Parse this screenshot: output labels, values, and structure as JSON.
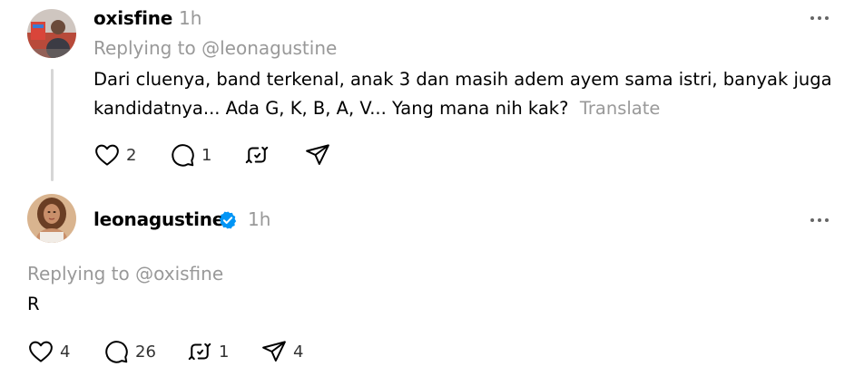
{
  "post1": {
    "username": "oxisfine",
    "time": "1h",
    "replying_to": "Replying to @leonagustine",
    "text_line1": "Dari cluenya, band terkenal, anak 3 dan masih adem ayem sama istri, banyak juga",
    "text_line2": "kandidatnya... Ada G, K, B, A, V... Yang mana nih kak?",
    "translate": "Translate",
    "likes": "2",
    "comments": "1",
    "reposts": "",
    "shares": ""
  },
  "post2": {
    "username": "leonagustine",
    "verified": true,
    "time": "1h",
    "replying_to": "Replying to @oxisfine",
    "text": "R",
    "likes": "4",
    "comments": "26",
    "reposts": "1",
    "shares": "4"
  },
  "icons": {
    "like": "heart-icon",
    "comment": "speech-bubble-icon",
    "repost": "repost-icon",
    "share": "paper-plane-icon",
    "more": "more-horizontal-icon",
    "verified": "verified-badge-icon"
  },
  "colors": {
    "text": "#000000",
    "muted": "#999999",
    "verified_blue": "#0095f6",
    "thread_line": "#d6d6d6"
  }
}
